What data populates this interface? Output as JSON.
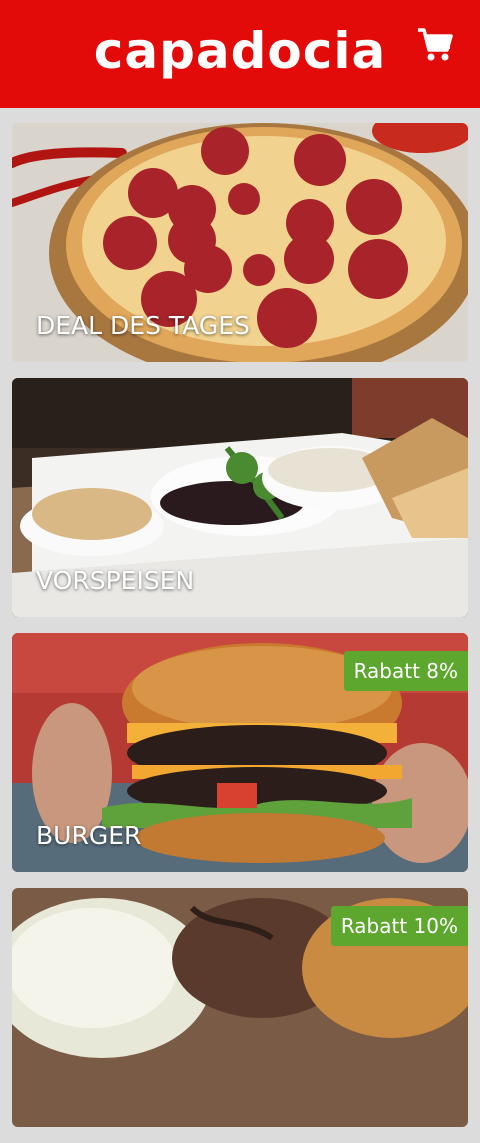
{
  "header": {
    "logo_text": "capadocia",
    "cart_icon": "cart-icon"
  },
  "categories": [
    {
      "title": "DEAL DES TAGES",
      "badge": ""
    },
    {
      "title": "VORSPEISEN",
      "badge": ""
    },
    {
      "title": "BURGER",
      "badge": "Rabatt 8%"
    },
    {
      "title": "",
      "badge": "Rabatt 10%"
    }
  ],
  "colors": {
    "brand_red": "#e30a0a",
    "badge_green": "#5ea72f"
  }
}
